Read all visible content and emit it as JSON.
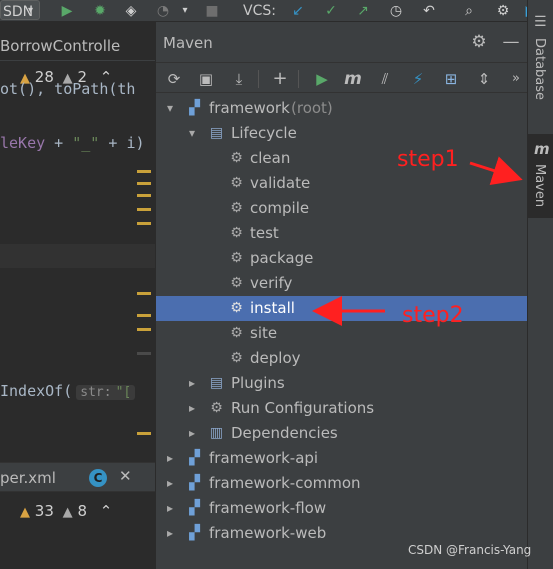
{
  "toolbar": {
    "run_config": "SDN",
    "vcs_label": "VCS:"
  },
  "editor": {
    "tab_title": "BorrowControlle",
    "warnings_top": {
      "warnings": "28",
      "weak_warnings": "2"
    },
    "code_line_1": "ot(), toPath(th",
    "code_line_2_parts": [
      "leKey",
      " + ",
      "\"_\"",
      " + ",
      "i)"
    ],
    "code_line_3": "IndexOf(",
    "code_line_3_hint": "str:",
    "code_line_3_tail": "\"[",
    "second_tab_title": "per.xml",
    "second_tab_badge": "C",
    "warnings_bottom": {
      "warnings": "33",
      "weak_warnings": "8"
    }
  },
  "maven": {
    "title": "Maven",
    "tree": [
      {
        "label": "framework",
        "suffix": " (root)",
        "level": 0,
        "expanded": true,
        "icon": "maven-module-icon"
      },
      {
        "label": "Lifecycle",
        "level": 1,
        "expanded": true,
        "icon": "lifecycle-folder-icon"
      },
      {
        "label": "clean",
        "level": 2,
        "icon": "gear-icon"
      },
      {
        "label": "validate",
        "level": 2,
        "icon": "gear-icon"
      },
      {
        "label": "compile",
        "level": 2,
        "icon": "gear-icon"
      },
      {
        "label": "test",
        "level": 2,
        "icon": "gear-icon"
      },
      {
        "label": "package",
        "level": 2,
        "icon": "gear-icon"
      },
      {
        "label": "verify",
        "level": 2,
        "icon": "gear-icon"
      },
      {
        "label": "install",
        "level": 2,
        "icon": "gear-icon",
        "selected": true
      },
      {
        "label": "site",
        "level": 2,
        "icon": "gear-icon"
      },
      {
        "label": "deploy",
        "level": 2,
        "icon": "gear-icon"
      },
      {
        "label": "Plugins",
        "level": 1,
        "expanded": false,
        "icon": "plugins-folder-icon"
      },
      {
        "label": "Run Configurations",
        "level": 1,
        "expanded": false,
        "icon": "gear-icon"
      },
      {
        "label": "Dependencies",
        "level": 1,
        "expanded": false,
        "icon": "dependencies-folder-icon"
      },
      {
        "label": "framework-api",
        "level": 0,
        "expanded": false,
        "icon": "maven-module-icon"
      },
      {
        "label": "framework-common",
        "level": 0,
        "expanded": false,
        "icon": "maven-module-icon"
      },
      {
        "label": "framework-flow",
        "level": 0,
        "expanded": false,
        "icon": "maven-module-icon"
      },
      {
        "label": "framework-web",
        "level": 0,
        "expanded": false,
        "icon": "maven-module-icon"
      }
    ]
  },
  "right_stripe": {
    "database_label": "Database",
    "maven_label": "Maven"
  },
  "annotations": {
    "step1": "step1",
    "step2": "step2",
    "color": "#ff2020"
  },
  "watermark": "CSDN @Francis-Yang",
  "colors": {
    "selection": "#4b6eaf",
    "panel": "#3c3f41",
    "editor_bg": "#2b2b2b",
    "run_green": "#59a869",
    "vcs_blue": "#3592c4"
  }
}
